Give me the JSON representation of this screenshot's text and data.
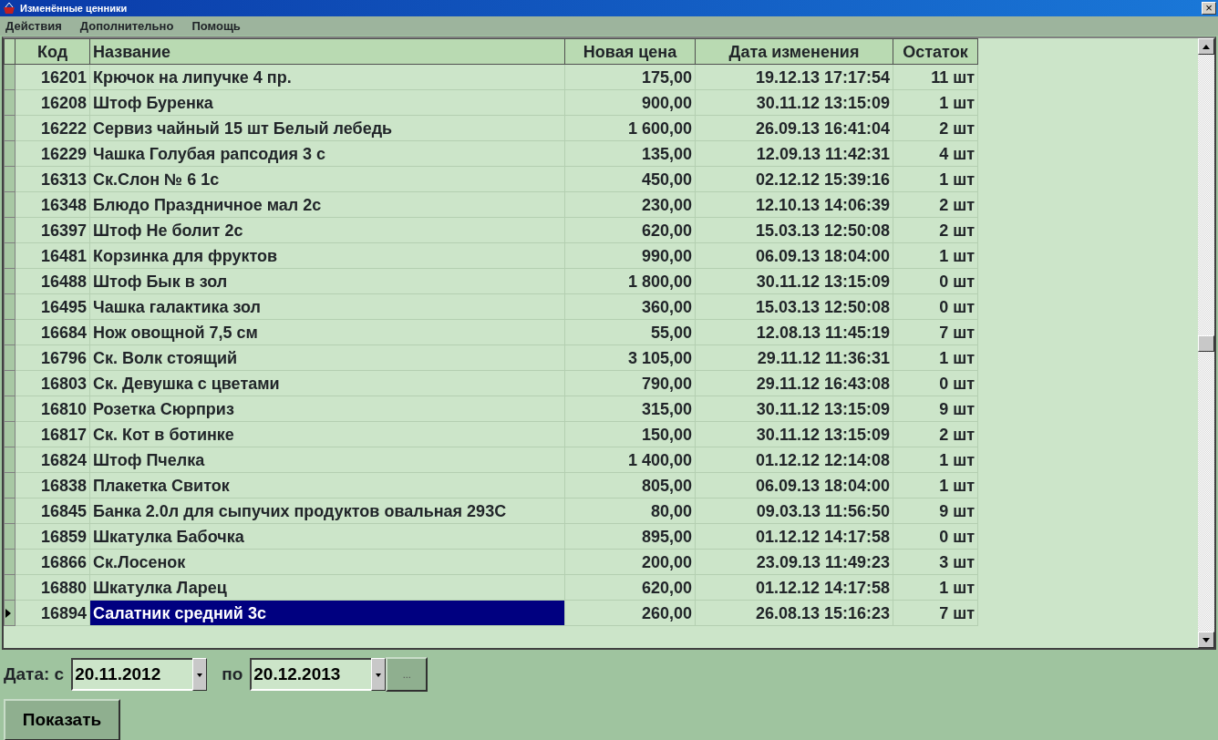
{
  "window": {
    "title": "Изменённые ценники",
    "close": "×"
  },
  "menu": [
    "Действия",
    "Дополнительно",
    "Помощь"
  ],
  "table": {
    "columns": [
      "Код",
      "Название",
      "Новая цена",
      "Дата изменения",
      "Остаток"
    ],
    "rows": [
      {
        "cells": [
          "16201",
          "Крючок на липучке 4 пр.",
          "175,00",
          "19.12.13 17:17:54",
          "11 шт"
        ],
        "selected": false
      },
      {
        "cells": [
          "16208",
          "Штоф Буренка",
          "900,00",
          "30.11.12 13:15:09",
          "1 шт"
        ],
        "selected": false
      },
      {
        "cells": [
          "16222",
          "Сервиз чайный 15 шт Белый лебедь",
          "1 600,00",
          "26.09.13 16:41:04",
          "2 шт"
        ],
        "selected": false
      },
      {
        "cells": [
          "16229",
          "Чашка Голубая рапсодия 3 с",
          "135,00",
          "12.09.13 11:42:31",
          "4 шт"
        ],
        "selected": false
      },
      {
        "cells": [
          "16313",
          "Ск.Слон № 6 1с",
          "450,00",
          "02.12.12 15:39:16",
          "1 шт"
        ],
        "selected": false
      },
      {
        "cells": [
          "16348",
          "Блюдо Праздничное мал 2с",
          "230,00",
          "12.10.13 14:06:39",
          "2 шт"
        ],
        "selected": false
      },
      {
        "cells": [
          "16397",
          "Штоф Не болит 2с",
          "620,00",
          "15.03.13 12:50:08",
          "2 шт"
        ],
        "selected": false
      },
      {
        "cells": [
          "16481",
          "Корзинка для фруктов",
          "990,00",
          "06.09.13 18:04:00",
          "1 шт"
        ],
        "selected": false
      },
      {
        "cells": [
          "16488",
          "Штоф Бык в зол",
          "1 800,00",
          "30.11.12 13:15:09",
          "0 шт"
        ],
        "selected": false
      },
      {
        "cells": [
          "16495",
          "Чашка галактика зол",
          "360,00",
          "15.03.13 12:50:08",
          "0 шт"
        ],
        "selected": false
      },
      {
        "cells": [
          "16684",
          "Нож овощной 7,5 см",
          "55,00",
          "12.08.13 11:45:19",
          "7 шт"
        ],
        "selected": false
      },
      {
        "cells": [
          "16796",
          "Ск. Волк стоящий",
          "3 105,00",
          "29.11.12 11:36:31",
          "1 шт"
        ],
        "selected": false
      },
      {
        "cells": [
          "16803",
          "Ск. Девушка с цветами",
          "790,00",
          "29.11.12 16:43:08",
          "0 шт"
        ],
        "selected": false
      },
      {
        "cells": [
          "16810",
          "Розетка Сюрприз",
          "315,00",
          "30.11.12 13:15:09",
          "9 шт"
        ],
        "selected": false
      },
      {
        "cells": [
          "16817",
          "Ск. Кот в ботинке",
          "150,00",
          "30.11.12 13:15:09",
          "2 шт"
        ],
        "selected": false
      },
      {
        "cells": [
          "16824",
          "Штоф Пчелка",
          "1 400,00",
          "01.12.12 12:14:08",
          "1 шт"
        ],
        "selected": false
      },
      {
        "cells": [
          "16838",
          "Плакетка Свиток",
          "805,00",
          "06.09.13 18:04:00",
          "1 шт"
        ],
        "selected": false
      },
      {
        "cells": [
          "16845",
          "Банка 2.0л для сыпучих продуктов овальная 293С",
          "80,00",
          "09.03.13 11:56:50",
          "9 шт"
        ],
        "selected": false
      },
      {
        "cells": [
          "16859",
          "Шкатулка Бабочка",
          "895,00",
          "01.12.12 14:17:58",
          "0 шт"
        ],
        "selected": false
      },
      {
        "cells": [
          "16866",
          "Ск.Лосенок",
          "200,00",
          "23.09.13 11:49:23",
          "3 шт"
        ],
        "selected": false
      },
      {
        "cells": [
          "16880",
          "Шкатулка Ларец",
          "620,00",
          "01.12.12 14:17:58",
          "1 шт"
        ],
        "selected": false
      },
      {
        "cells": [
          "16894",
          "Салатник средний 3с",
          "260,00",
          "26.08.13 15:16:23",
          "7 шт"
        ],
        "selected": true
      }
    ]
  },
  "filter": {
    "label_from": "Дата: с",
    "date_from": "20.11.2012",
    "label_to": "по",
    "date_to": "20.12.2013",
    "more_button": "...",
    "show_button": "Показать"
  }
}
